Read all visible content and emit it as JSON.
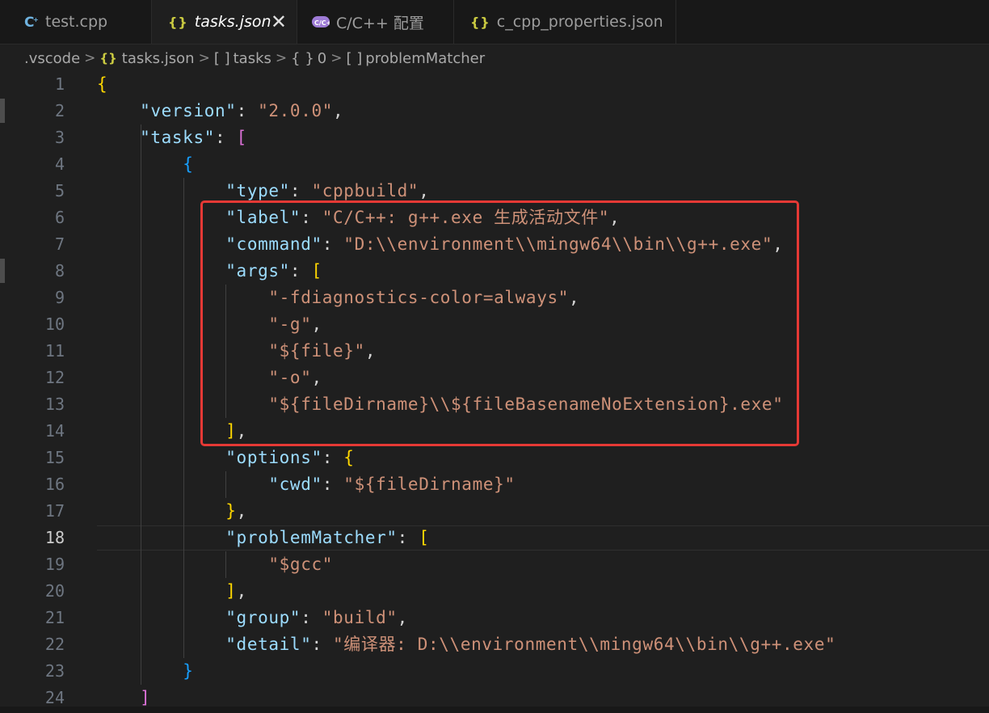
{
  "tabs": [
    {
      "label": "test.cpp",
      "icon": "cpp-file-icon",
      "active": false
    },
    {
      "label": "tasks.json",
      "icon": "json-file-icon",
      "active": true
    },
    {
      "label": "C/C++ 配置",
      "icon": "cpp-extension-icon",
      "active": false
    },
    {
      "label": "c_cpp_properties.json",
      "icon": "json-file-icon",
      "active": false
    }
  ],
  "breadcrumb": {
    "items": [
      ".vscode",
      "tasks.json",
      "tasks",
      "0",
      "problemMatcher"
    ],
    "icons": [
      null,
      "json-icon",
      "array-icon",
      "object-icon",
      "array-icon"
    ]
  },
  "editor": {
    "current_line": 18,
    "highlight_color": "#e53935",
    "lines": [
      {
        "n": "1",
        "t": [
          [
            "{",
            "b1"
          ]
        ]
      },
      {
        "n": "2",
        "t": [
          [
            "    ",
            ""
          ],
          [
            "\"version\"",
            "k"
          ],
          [
            ": ",
            ""
          ],
          [
            "\"2.0.0\"",
            "s"
          ],
          [
            ",",
            ""
          ]
        ]
      },
      {
        "n": "3",
        "t": [
          [
            "    ",
            ""
          ],
          [
            "\"tasks\"",
            "k"
          ],
          [
            ": ",
            ""
          ],
          [
            "[",
            "b2"
          ]
        ]
      },
      {
        "n": "4",
        "t": [
          [
            "        ",
            ""
          ],
          [
            "{",
            "b3"
          ]
        ]
      },
      {
        "n": "5",
        "t": [
          [
            "            ",
            ""
          ],
          [
            "\"type\"",
            "k"
          ],
          [
            ": ",
            ""
          ],
          [
            "\"cppbuild\"",
            "s"
          ],
          [
            ",",
            ""
          ]
        ]
      },
      {
        "n": "6",
        "t": [
          [
            "            ",
            ""
          ],
          [
            "\"label\"",
            "k"
          ],
          [
            ": ",
            ""
          ],
          [
            "\"C/C++: g++.exe 生成活动文件\"",
            "s"
          ],
          [
            ",",
            ""
          ]
        ]
      },
      {
        "n": "7",
        "t": [
          [
            "            ",
            ""
          ],
          [
            "\"command\"",
            "k"
          ],
          [
            ": ",
            ""
          ],
          [
            "\"D:\\\\environment\\\\mingw64\\\\bin\\\\g++.exe\"",
            "s"
          ],
          [
            ",",
            ""
          ]
        ]
      },
      {
        "n": "8",
        "t": [
          [
            "            ",
            ""
          ],
          [
            "\"args\"",
            "k"
          ],
          [
            ": ",
            ""
          ],
          [
            "[",
            "b1"
          ]
        ]
      },
      {
        "n": "9",
        "t": [
          [
            "                ",
            ""
          ],
          [
            "\"-fdiagnostics-color=always\"",
            "s"
          ],
          [
            ",",
            ""
          ]
        ]
      },
      {
        "n": "10",
        "t": [
          [
            "                ",
            ""
          ],
          [
            "\"-g\"",
            "s"
          ],
          [
            ",",
            ""
          ]
        ]
      },
      {
        "n": "11",
        "t": [
          [
            "                ",
            ""
          ],
          [
            "\"${file}\"",
            "s"
          ],
          [
            ",",
            ""
          ]
        ]
      },
      {
        "n": "12",
        "t": [
          [
            "                ",
            ""
          ],
          [
            "\"-o\"",
            "s"
          ],
          [
            ",",
            ""
          ]
        ]
      },
      {
        "n": "13",
        "t": [
          [
            "                ",
            ""
          ],
          [
            "\"${fileDirname}\\\\${fileBasenameNoExtension}.exe\"",
            "s"
          ]
        ]
      },
      {
        "n": "14",
        "t": [
          [
            "            ",
            ""
          ],
          [
            "]",
            "b1"
          ],
          [
            ",",
            ""
          ]
        ]
      },
      {
        "n": "15",
        "t": [
          [
            "            ",
            ""
          ],
          [
            "\"options\"",
            "k"
          ],
          [
            ": ",
            ""
          ],
          [
            "{",
            "b1"
          ]
        ]
      },
      {
        "n": "16",
        "t": [
          [
            "                ",
            ""
          ],
          [
            "\"cwd\"",
            "k"
          ],
          [
            ": ",
            ""
          ],
          [
            "\"${fileDirname}\"",
            "s"
          ]
        ]
      },
      {
        "n": "17",
        "t": [
          [
            "            ",
            ""
          ],
          [
            "}",
            "b1"
          ],
          [
            ",",
            ""
          ]
        ]
      },
      {
        "n": "18",
        "t": [
          [
            "            ",
            ""
          ],
          [
            "\"problemMatcher\"",
            "k"
          ],
          [
            ": ",
            ""
          ],
          [
            "[",
            "b1"
          ]
        ]
      },
      {
        "n": "19",
        "t": [
          [
            "                ",
            ""
          ],
          [
            "\"$gcc\"",
            "s"
          ]
        ]
      },
      {
        "n": "20",
        "t": [
          [
            "            ",
            ""
          ],
          [
            "]",
            "b1"
          ],
          [
            ",",
            ""
          ]
        ]
      },
      {
        "n": "21",
        "t": [
          [
            "            ",
            ""
          ],
          [
            "\"group\"",
            "k"
          ],
          [
            ": ",
            ""
          ],
          [
            "\"build\"",
            "s"
          ],
          [
            ",",
            ""
          ]
        ]
      },
      {
        "n": "22",
        "t": [
          [
            "            ",
            ""
          ],
          [
            "\"detail\"",
            "k"
          ],
          [
            ": ",
            ""
          ],
          [
            "\"编译器: D:\\\\environment\\\\mingw64\\\\bin\\\\g++.exe\"",
            "s"
          ]
        ]
      },
      {
        "n": "23",
        "t": [
          [
            "        ",
            ""
          ],
          [
            "}",
            "b3"
          ]
        ]
      },
      {
        "n": "24",
        "t": [
          [
            "    ",
            ""
          ],
          [
            "]",
            "b2"
          ]
        ]
      }
    ]
  }
}
